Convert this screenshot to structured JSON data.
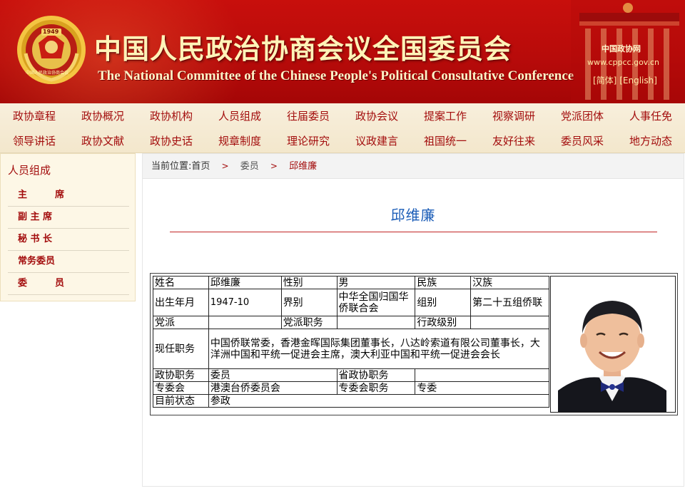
{
  "header": {
    "title_cn": "中国人民政治协商会议全国委员会",
    "title_en": "The National Committee of the  Chinese People's Political Consultative Conference",
    "emblem_year": "1949",
    "emblem_text": "中国人民政治协商会议",
    "site_name": "中国政协网",
    "site_url": "www.cppcc.gov.cn",
    "lang_simplified": "[简体]",
    "lang_english": "[English]"
  },
  "nav": {
    "row1": [
      "政协章程",
      "政协概况",
      "政协机构",
      "人员组成",
      "往届委员",
      "政协会议",
      "提案工作",
      "视察调研",
      "党派团体",
      "人事任免"
    ],
    "row2": [
      "领导讲话",
      "政协文献",
      "政协史话",
      "规章制度",
      "理论研究",
      "议政建言",
      "祖国统一",
      "友好往来",
      "委员风采",
      "地方动态"
    ]
  },
  "sidebar": {
    "title": "人员组成",
    "items": [
      "主　　　席",
      "副 主 席",
      "秘 书 长",
      "常务委员",
      "委　　　员"
    ]
  },
  "breadcrumb": {
    "prefix": "当前位置:",
    "home": "首页",
    "level1": "委员",
    "current": "邱维廉",
    "separator": ">"
  },
  "profile": {
    "name": "邱维廉",
    "labels": {
      "name": "姓名",
      "gender": "性别",
      "ethnicity": "民族",
      "birth": "出生年月",
      "sector": "界别",
      "group": "组别",
      "party": "党派",
      "party_post": "党派职务",
      "admin_level": "行政级别",
      "current_post": "现任职务",
      "cppcc_post": "政协职务",
      "provincial_post": "省政协职务",
      "committee": "专委会",
      "committee_post": "专委会职务",
      "status": "目前状态"
    },
    "values": {
      "name": "邱维廉",
      "gender": "男",
      "ethnicity": "汉族",
      "birth": "1947-10",
      "sector": "中华全国归国华侨联合会",
      "group": "第二十五组侨联",
      "party": "",
      "party_post": "",
      "admin_level": "",
      "current_post": "中国侨联常委，香港金晖国际集团董事长，八达岭索道有限公司董事长，大洋洲中国和平统一促进会主席，澳大利亚中国和平统一促进会会长",
      "cppcc_post": "委员",
      "provincial_post": "",
      "committee": "港澳台侨委员会",
      "committee_post": "专委",
      "status": "参政"
    }
  },
  "colors": {
    "banner_red": "#b80b0a",
    "nav_text": "#a30d0d",
    "name_blue": "#1a5cb7",
    "rule_red": "#c12424"
  }
}
